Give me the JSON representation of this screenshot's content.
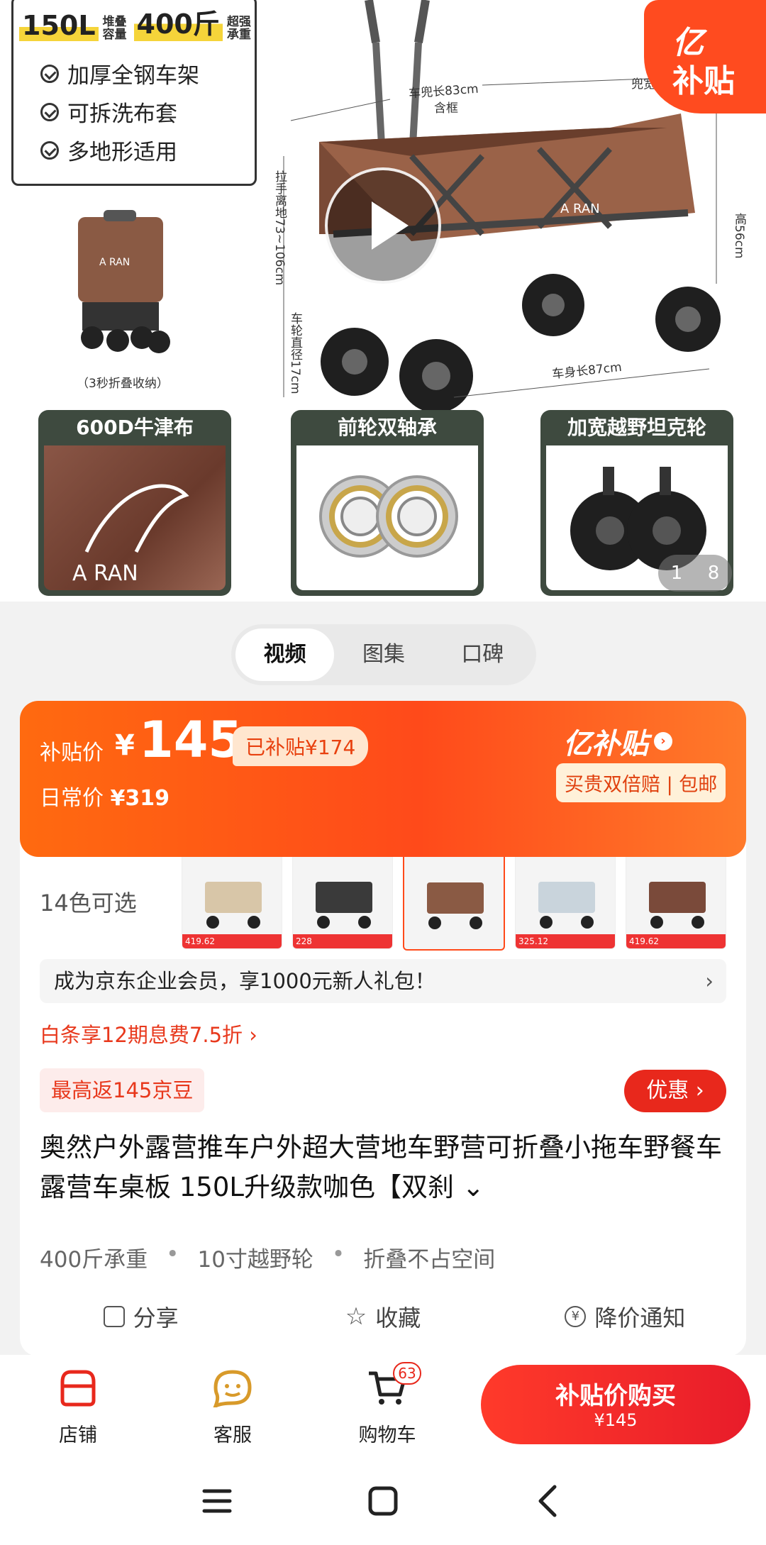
{
  "hero": {
    "spec_capacity": "150L",
    "spec_capacity_sub": "堆叠 容量",
    "spec_load": "400斤",
    "spec_load_sub": "超强 承重",
    "features": [
      "加厚全钢车架",
      "可拆洗布套",
      "多地形适用"
    ],
    "fold_note": "（3秒折叠收纳）",
    "badge_line1": "亿",
    "badge_line2": "补贴",
    "dims": {
      "basket_length": "车兜长83cm",
      "basket_frame": "含框",
      "basket_width": "兜宽",
      "handle_height": "拉手离地73~106cm",
      "wheel_diameter": "车轮直径17cm",
      "height": "高56cm",
      "body_length": "车身长87cm"
    },
    "brand_mark": "A RAN",
    "feature_cards": [
      "600D牛津布",
      "前轮双轴承",
      "加宽越野坦克轮"
    ],
    "page_current": "1",
    "page_total": "8"
  },
  "tabs": [
    {
      "label": "视频",
      "active": true
    },
    {
      "label": "图集",
      "active": false
    },
    {
      "label": "口碑",
      "active": false
    }
  ],
  "price": {
    "label": "补贴价",
    "currency": "¥",
    "value": "145",
    "subsidy": "已补贴¥174",
    "daily_label": "日常价",
    "daily_value": "¥319",
    "brand": "亿补贴",
    "guarantee": "买贵双倍赔 | 包邮"
  },
  "colors": {
    "label": "14色可选",
    "thumb_prices": [
      "419.62",
      "228",
      "",
      "325.12",
      "419.62"
    ],
    "thumb_tints": [
      "#d8c6a8",
      "#3a3a3a",
      "#8a5a44",
      "#c9d4dc",
      "#7a4a3a"
    ]
  },
  "member_banner": "成为京东企业会员，享1000元新人礼包！",
  "member_chevron": "›",
  "baitiao": "白条享12期息费7.5折 ›",
  "bean": "最高返145京豆",
  "youhui": "优惠",
  "product_title": "奥然户外露营推车户外超大营地车野营可折叠小拖车野餐车露营车桌板 150L升级款咖色【双刹 ⌄",
  "tags": [
    "400斤承重",
    "10寸越野轮",
    "折叠不占空间"
  ],
  "actions": [
    "分享",
    "收藏",
    "降价通知"
  ],
  "bottom": {
    "store": "店铺",
    "service": "客服",
    "cart": "购物车",
    "cart_count": "63",
    "buy_line1": "补贴价购买",
    "buy_line2": "¥145"
  },
  "accent": "#ff4a1a",
  "red": "#e8281c"
}
